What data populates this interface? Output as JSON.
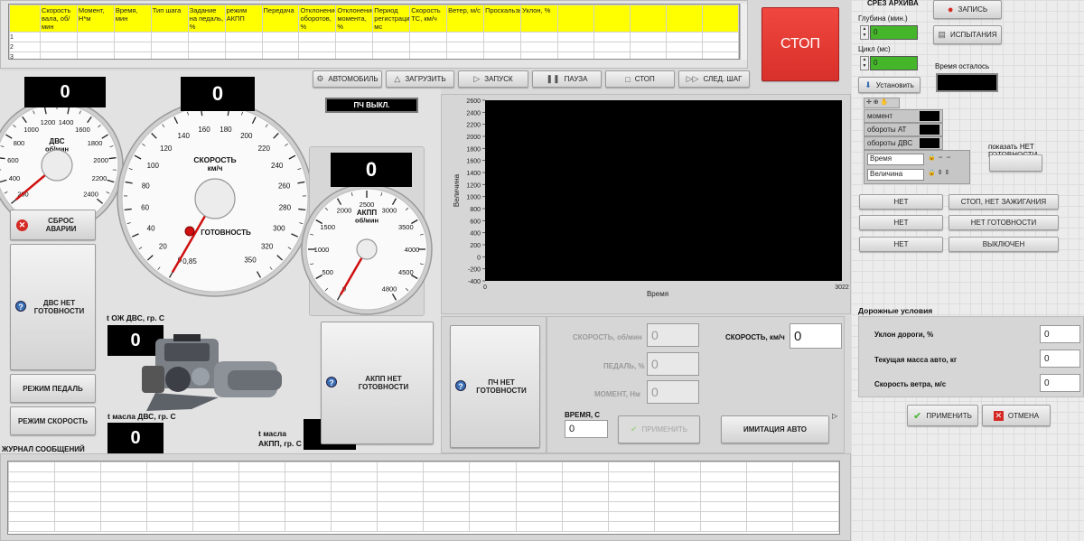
{
  "table": {
    "headers": [
      "Скорость вала, об/мин",
      "Момент, Н*м",
      "Время, мин",
      "Тип шага",
      "Задание на педаль, %",
      "режим АКПП",
      "Передача",
      "Отклонение оборотов, %",
      "Отклонение момента, %",
      "Период регистрации, мс",
      "Скорость ТС, км/ч",
      "Ветер, м/с",
      "Проскальзывание",
      "Уклон, %"
    ],
    "rows": [
      "1",
      "2",
      "3",
      "4"
    ]
  },
  "stop_big_label": "СТОП",
  "toolbar": {
    "automobile": "АВТОМОБИЛЬ",
    "load": "ЗАГРУЗИТЬ",
    "start": "ЗАПУСК",
    "pause": "ПАУЗА",
    "stop": "СТОП",
    "next_step": "СЛЕД. ШАГ"
  },
  "pch_status": "ПЧ ВЫКЛ.",
  "engine_gauge": {
    "title": "ДВС",
    "unit": "об/мин",
    "display": "0",
    "ticks": [
      "200",
      "400",
      "600",
      "800",
      "1000",
      "1200",
      "1400",
      "1600",
      "1800",
      "2000",
      "2200",
      "2400"
    ]
  },
  "speed_gauge": {
    "title": "СКОРОСТЬ",
    "unit": "км/ч",
    "display": "0",
    "ticks": [
      "0",
      "20",
      "40",
      "60",
      "80",
      "100",
      "120",
      "140",
      "160",
      "180",
      "200",
      "220",
      "240",
      "260",
      "280",
      "300",
      "320",
      "350"
    ],
    "readiness": "ГОТОВНОСТЬ",
    "low_value": "0,85"
  },
  "akpp_gauge": {
    "title": "АКПП",
    "unit": "об/мин",
    "display": "0",
    "ticks": [
      "0",
      "500",
      "1000",
      "1500",
      "2000",
      "2500",
      "3000",
      "3500",
      "4000",
      "4500",
      "4800"
    ]
  },
  "left_buttons": {
    "reset": "СБРОС АВАРИИ",
    "dvs_not_ready": "ДВС НЕТ ГОТОВНОСТИ",
    "pedal_mode": "РЕЖИМ ПЕДАЛЬ",
    "speed_mode": "РЕЖИМ СКОРОСТЬ"
  },
  "temps": {
    "coolant_label": "t ОЖ ДВС, гр. С",
    "coolant_value": "0",
    "oil_dvs_label": "t масла ДВС, гр. С",
    "oil_dvs_value": "0",
    "oil_akpp_label": "t масла АКПП, гр. С",
    "oil_akpp_value": "0"
  },
  "akpp_not_ready": "АКПП НЕТ ГОТОВНОСТИ",
  "pch_not_ready": "ПЧ НЕТ ГОТОВНОСТИ",
  "chart_data": {
    "type": "line",
    "ylabel": "Величина",
    "xlabel": "Время",
    "ylim": [
      -400,
      2600
    ],
    "xlim": [
      0,
      3022
    ],
    "yticks": [
      "2600",
      "2400",
      "2200",
      "2000",
      "1800",
      "1600",
      "1400",
      "1200",
      "1000",
      "800",
      "600",
      "400",
      "200",
      "0",
      "-200",
      "-400"
    ],
    "xticks": [
      "0",
      "3022"
    ],
    "series": []
  },
  "controls": {
    "speed_rpm_label": "СКОРОСТЬ, об/мин",
    "speed_rpm_value": "0",
    "pedal_label": "ПЕДАЛЬ, %",
    "pedal_value": "0",
    "moment_label": "МОМЕНТ, Нм",
    "moment_value": "0",
    "speed_kmh_label": "СКОРОСТЬ, км/ч",
    "speed_kmh_value": "0",
    "time_label": "ВРЕМЯ, С",
    "time_value": "0",
    "apply": "ПРИМЕНИТЬ",
    "imitation": "ИМИТАЦИЯ АВТО"
  },
  "journal_label": "ЖУРНАЛ СООБЩЕНИЙ",
  "right": {
    "archive_cut": "СРЕЗ АРХИВА",
    "depth_label": "Глубина (мин.)",
    "depth_value": "0",
    "cycle_label": "Цикл (мс)",
    "cycle_value": "0",
    "install": "Установить",
    "record": "ЗАПИСЬ",
    "tests": "ИСПЫТАНИЯ",
    "time_left_label": "Время осталось",
    "legend": [
      "момент",
      "обороты АТ",
      "обороты ДВС"
    ],
    "scale_time": "Время",
    "scale_value": "Величина",
    "show_not_ready": "показать НЕТ ГОТОВНОСТИ",
    "status_left": [
      "НЕТ",
      "НЕТ",
      "НЕТ"
    ],
    "status_right": [
      "СТОП, НЕТ ЗАЖИГАНИЯ",
      "НЕТ ГОТОВНОСТИ",
      "ВЫКЛЮЧЕН"
    ],
    "road_title": "Дорожные условия",
    "road_labels": [
      "Уклон дороги, %",
      "Текущая масса авто, кг",
      "Скорость ветра, м/с"
    ],
    "road_values": [
      "0",
      "0",
      "0"
    ],
    "apply": "ПРИМЕНИТЬ",
    "cancel": "ОТМЕНА"
  },
  "colors": {
    "stop_red": "#e23a33",
    "header_yellow": "#ffff00",
    "green_fill": "#45b52a",
    "needle_red": "#d01010"
  }
}
